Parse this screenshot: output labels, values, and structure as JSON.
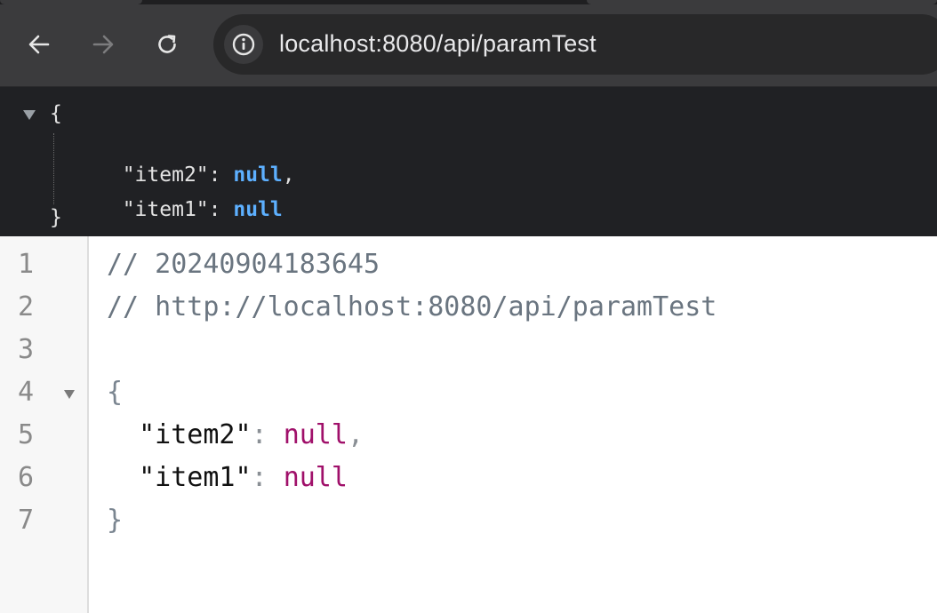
{
  "browser": {
    "url": "localhost:8080/api/paramTest",
    "icons": {
      "back": "arrow-left-icon",
      "forward": "arrow-right-icon",
      "reload": "reload-icon",
      "site_info": "info-icon"
    }
  },
  "json_view": {
    "open_brace": "{",
    "close_brace": "}",
    "entries": [
      {
        "key": "\"item2\"",
        "colon": ": ",
        "value": "null",
        "comma": ","
      },
      {
        "key": "\"item1\"",
        "colon": ": ",
        "value": "null",
        "comma": ""
      }
    ]
  },
  "editor": {
    "line_numbers": [
      "1",
      "2",
      "3",
      "4",
      "5",
      "6",
      "7"
    ],
    "comment_timestamp": "// 20240904183645",
    "comment_url": "// http://localhost:8080/api/paramTest",
    "open_brace": "{",
    "close_brace": "}",
    "entries": [
      {
        "indent": "  ",
        "key": "\"item2\"",
        "colon": ": ",
        "value": "null",
        "comma": ","
      },
      {
        "indent": "  ",
        "key": "\"item1\"",
        "colon": ": ",
        "value": "null",
        "comma": ""
      }
    ]
  },
  "colors": {
    "chrome_bg": "#3b3b3d",
    "omnibox_bg": "#282829",
    "json_view_bg": "#202124",
    "json_null": "#5db0ff",
    "editor_null": "#a0106a",
    "editor_comment": "#6a7580"
  }
}
